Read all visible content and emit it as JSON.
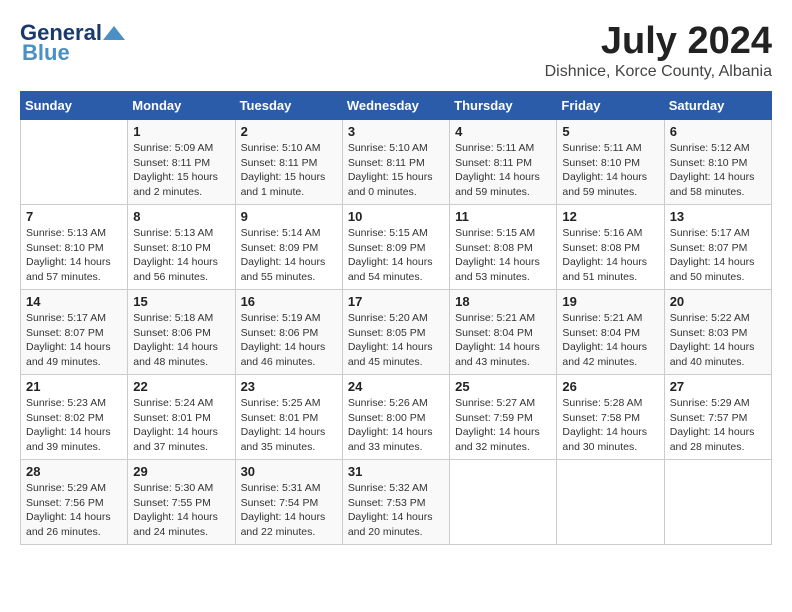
{
  "header": {
    "logo_general": "General",
    "logo_blue": "Blue",
    "month": "July 2024",
    "location": "Dishnice, Korce County, Albania"
  },
  "weekdays": [
    "Sunday",
    "Monday",
    "Tuesday",
    "Wednesday",
    "Thursday",
    "Friday",
    "Saturday"
  ],
  "weeks": [
    [
      {
        "day": "",
        "sunrise": "",
        "sunset": "",
        "daylight": ""
      },
      {
        "day": "1",
        "sunrise": "Sunrise: 5:09 AM",
        "sunset": "Sunset: 8:11 PM",
        "daylight": "Daylight: 15 hours and 2 minutes."
      },
      {
        "day": "2",
        "sunrise": "Sunrise: 5:10 AM",
        "sunset": "Sunset: 8:11 PM",
        "daylight": "Daylight: 15 hours and 1 minute."
      },
      {
        "day": "3",
        "sunrise": "Sunrise: 5:10 AM",
        "sunset": "Sunset: 8:11 PM",
        "daylight": "Daylight: 15 hours and 0 minutes."
      },
      {
        "day": "4",
        "sunrise": "Sunrise: 5:11 AM",
        "sunset": "Sunset: 8:11 PM",
        "daylight": "Daylight: 14 hours and 59 minutes."
      },
      {
        "day": "5",
        "sunrise": "Sunrise: 5:11 AM",
        "sunset": "Sunset: 8:10 PM",
        "daylight": "Daylight: 14 hours and 59 minutes."
      },
      {
        "day": "6",
        "sunrise": "Sunrise: 5:12 AM",
        "sunset": "Sunset: 8:10 PM",
        "daylight": "Daylight: 14 hours and 58 minutes."
      }
    ],
    [
      {
        "day": "7",
        "sunrise": "Sunrise: 5:13 AM",
        "sunset": "Sunset: 8:10 PM",
        "daylight": "Daylight: 14 hours and 57 minutes."
      },
      {
        "day": "8",
        "sunrise": "Sunrise: 5:13 AM",
        "sunset": "Sunset: 8:10 PM",
        "daylight": "Daylight: 14 hours and 56 minutes."
      },
      {
        "day": "9",
        "sunrise": "Sunrise: 5:14 AM",
        "sunset": "Sunset: 8:09 PM",
        "daylight": "Daylight: 14 hours and 55 minutes."
      },
      {
        "day": "10",
        "sunrise": "Sunrise: 5:15 AM",
        "sunset": "Sunset: 8:09 PM",
        "daylight": "Daylight: 14 hours and 54 minutes."
      },
      {
        "day": "11",
        "sunrise": "Sunrise: 5:15 AM",
        "sunset": "Sunset: 8:08 PM",
        "daylight": "Daylight: 14 hours and 53 minutes."
      },
      {
        "day": "12",
        "sunrise": "Sunrise: 5:16 AM",
        "sunset": "Sunset: 8:08 PM",
        "daylight": "Daylight: 14 hours and 51 minutes."
      },
      {
        "day": "13",
        "sunrise": "Sunrise: 5:17 AM",
        "sunset": "Sunset: 8:07 PM",
        "daylight": "Daylight: 14 hours and 50 minutes."
      }
    ],
    [
      {
        "day": "14",
        "sunrise": "Sunrise: 5:17 AM",
        "sunset": "Sunset: 8:07 PM",
        "daylight": "Daylight: 14 hours and 49 minutes."
      },
      {
        "day": "15",
        "sunrise": "Sunrise: 5:18 AM",
        "sunset": "Sunset: 8:06 PM",
        "daylight": "Daylight: 14 hours and 48 minutes."
      },
      {
        "day": "16",
        "sunrise": "Sunrise: 5:19 AM",
        "sunset": "Sunset: 8:06 PM",
        "daylight": "Daylight: 14 hours and 46 minutes."
      },
      {
        "day": "17",
        "sunrise": "Sunrise: 5:20 AM",
        "sunset": "Sunset: 8:05 PM",
        "daylight": "Daylight: 14 hours and 45 minutes."
      },
      {
        "day": "18",
        "sunrise": "Sunrise: 5:21 AM",
        "sunset": "Sunset: 8:04 PM",
        "daylight": "Daylight: 14 hours and 43 minutes."
      },
      {
        "day": "19",
        "sunrise": "Sunrise: 5:21 AM",
        "sunset": "Sunset: 8:04 PM",
        "daylight": "Daylight: 14 hours and 42 minutes."
      },
      {
        "day": "20",
        "sunrise": "Sunrise: 5:22 AM",
        "sunset": "Sunset: 8:03 PM",
        "daylight": "Daylight: 14 hours and 40 minutes."
      }
    ],
    [
      {
        "day": "21",
        "sunrise": "Sunrise: 5:23 AM",
        "sunset": "Sunset: 8:02 PM",
        "daylight": "Daylight: 14 hours and 39 minutes."
      },
      {
        "day": "22",
        "sunrise": "Sunrise: 5:24 AM",
        "sunset": "Sunset: 8:01 PM",
        "daylight": "Daylight: 14 hours and 37 minutes."
      },
      {
        "day": "23",
        "sunrise": "Sunrise: 5:25 AM",
        "sunset": "Sunset: 8:01 PM",
        "daylight": "Daylight: 14 hours and 35 minutes."
      },
      {
        "day": "24",
        "sunrise": "Sunrise: 5:26 AM",
        "sunset": "Sunset: 8:00 PM",
        "daylight": "Daylight: 14 hours and 33 minutes."
      },
      {
        "day": "25",
        "sunrise": "Sunrise: 5:27 AM",
        "sunset": "Sunset: 7:59 PM",
        "daylight": "Daylight: 14 hours and 32 minutes."
      },
      {
        "day": "26",
        "sunrise": "Sunrise: 5:28 AM",
        "sunset": "Sunset: 7:58 PM",
        "daylight": "Daylight: 14 hours and 30 minutes."
      },
      {
        "day": "27",
        "sunrise": "Sunrise: 5:29 AM",
        "sunset": "Sunset: 7:57 PM",
        "daylight": "Daylight: 14 hours and 28 minutes."
      }
    ],
    [
      {
        "day": "28",
        "sunrise": "Sunrise: 5:29 AM",
        "sunset": "Sunset: 7:56 PM",
        "daylight": "Daylight: 14 hours and 26 minutes."
      },
      {
        "day": "29",
        "sunrise": "Sunrise: 5:30 AM",
        "sunset": "Sunset: 7:55 PM",
        "daylight": "Daylight: 14 hours and 24 minutes."
      },
      {
        "day": "30",
        "sunrise": "Sunrise: 5:31 AM",
        "sunset": "Sunset: 7:54 PM",
        "daylight": "Daylight: 14 hours and 22 minutes."
      },
      {
        "day": "31",
        "sunrise": "Sunrise: 5:32 AM",
        "sunset": "Sunset: 7:53 PM",
        "daylight": "Daylight: 14 hours and 20 minutes."
      },
      {
        "day": "",
        "sunrise": "",
        "sunset": "",
        "daylight": ""
      },
      {
        "day": "",
        "sunrise": "",
        "sunset": "",
        "daylight": ""
      },
      {
        "day": "",
        "sunrise": "",
        "sunset": "",
        "daylight": ""
      }
    ]
  ]
}
